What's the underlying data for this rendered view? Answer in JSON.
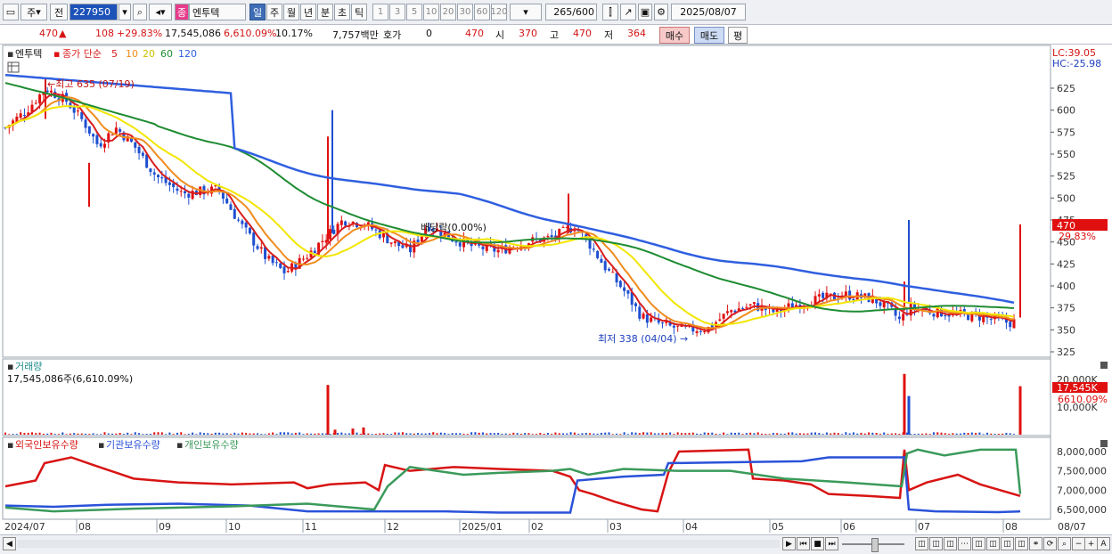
{
  "toolbar": {
    "period_main": "주",
    "period_alt": "전",
    "code": "227950",
    "stock_badge": "종",
    "stock_name": "엔투텍",
    "periods": [
      "일",
      "주",
      "월",
      "년",
      "분",
      "초",
      "틱"
    ],
    "ticks": [
      "1",
      "3",
      "5",
      "10",
      "20",
      "30",
      "60",
      "120"
    ],
    "count": "265",
    "count_total": "/600",
    "date": "2025/08/07"
  },
  "info": {
    "price": "470",
    "change": "108",
    "change_pct": "+29.83%",
    "volume": "17,545,086",
    "volume_pct": "6,610.09%",
    "turnover": "10.17%",
    "amount": "7,757백만",
    "quote_label": "호가",
    "quote_val": "0",
    "quote_price": "470",
    "open_label": "시",
    "open_val": "370",
    "high_label": "고",
    "high_val": "470",
    "low_label": "저",
    "low_val": "364",
    "buy": "매수",
    "sell": "매도",
    "avg": "평"
  },
  "price_panel": {
    "stock_label": "엔투텍",
    "ma_label": "종가 단순",
    "ma_periods": [
      "5",
      "10",
      "20",
      "60",
      "120"
    ],
    "lc": "LC:39.05",
    "hc": "HC:-25.98",
    "high_note": "최고 635 (07/19)",
    "low_note": "최저 338 (04/04)",
    "ex_note": "배당락(0.00%)",
    "current_label": "470",
    "current_pct": "29.83%",
    "y_ticks": [
      "625",
      "600",
      "575",
      "550",
      "525",
      "500",
      "475",
      "450",
      "425",
      "400",
      "375",
      "350",
      "325"
    ]
  },
  "volume_panel": {
    "title": "거래량",
    "value": "17,545,086주(6,610.09%)",
    "y_ticks": [
      "20,000K",
      "10,000K"
    ],
    "current_label": "17,545K",
    "current_pct": "6610.09%"
  },
  "holding_panel": {
    "foreign_label": "외국인보유수량",
    "inst_label": "기관보유수량",
    "indiv_label": "개인보유수량",
    "y_ticks": [
      "8,000,000",
      "7,500,000",
      "7,000,000",
      "6,500,000"
    ]
  },
  "x_axis": [
    "2024/07",
    "08",
    "09",
    "10",
    "11",
    "12",
    "2025/01",
    "02",
    "03",
    "04",
    "05",
    "06",
    "07",
    "08",
    "08/07"
  ],
  "colors": {
    "up": "#e01010",
    "down": "#1d4fd0",
    "ma5": "#d81e1e",
    "ma10": "#f08c1e",
    "ma20": "#f2e600",
    "ma60": "#1e8c32",
    "ma120": "#2f5fe0",
    "foreign": "#d81414",
    "inst": "#2a52d8",
    "indiv": "#3a9a5a"
  }
}
